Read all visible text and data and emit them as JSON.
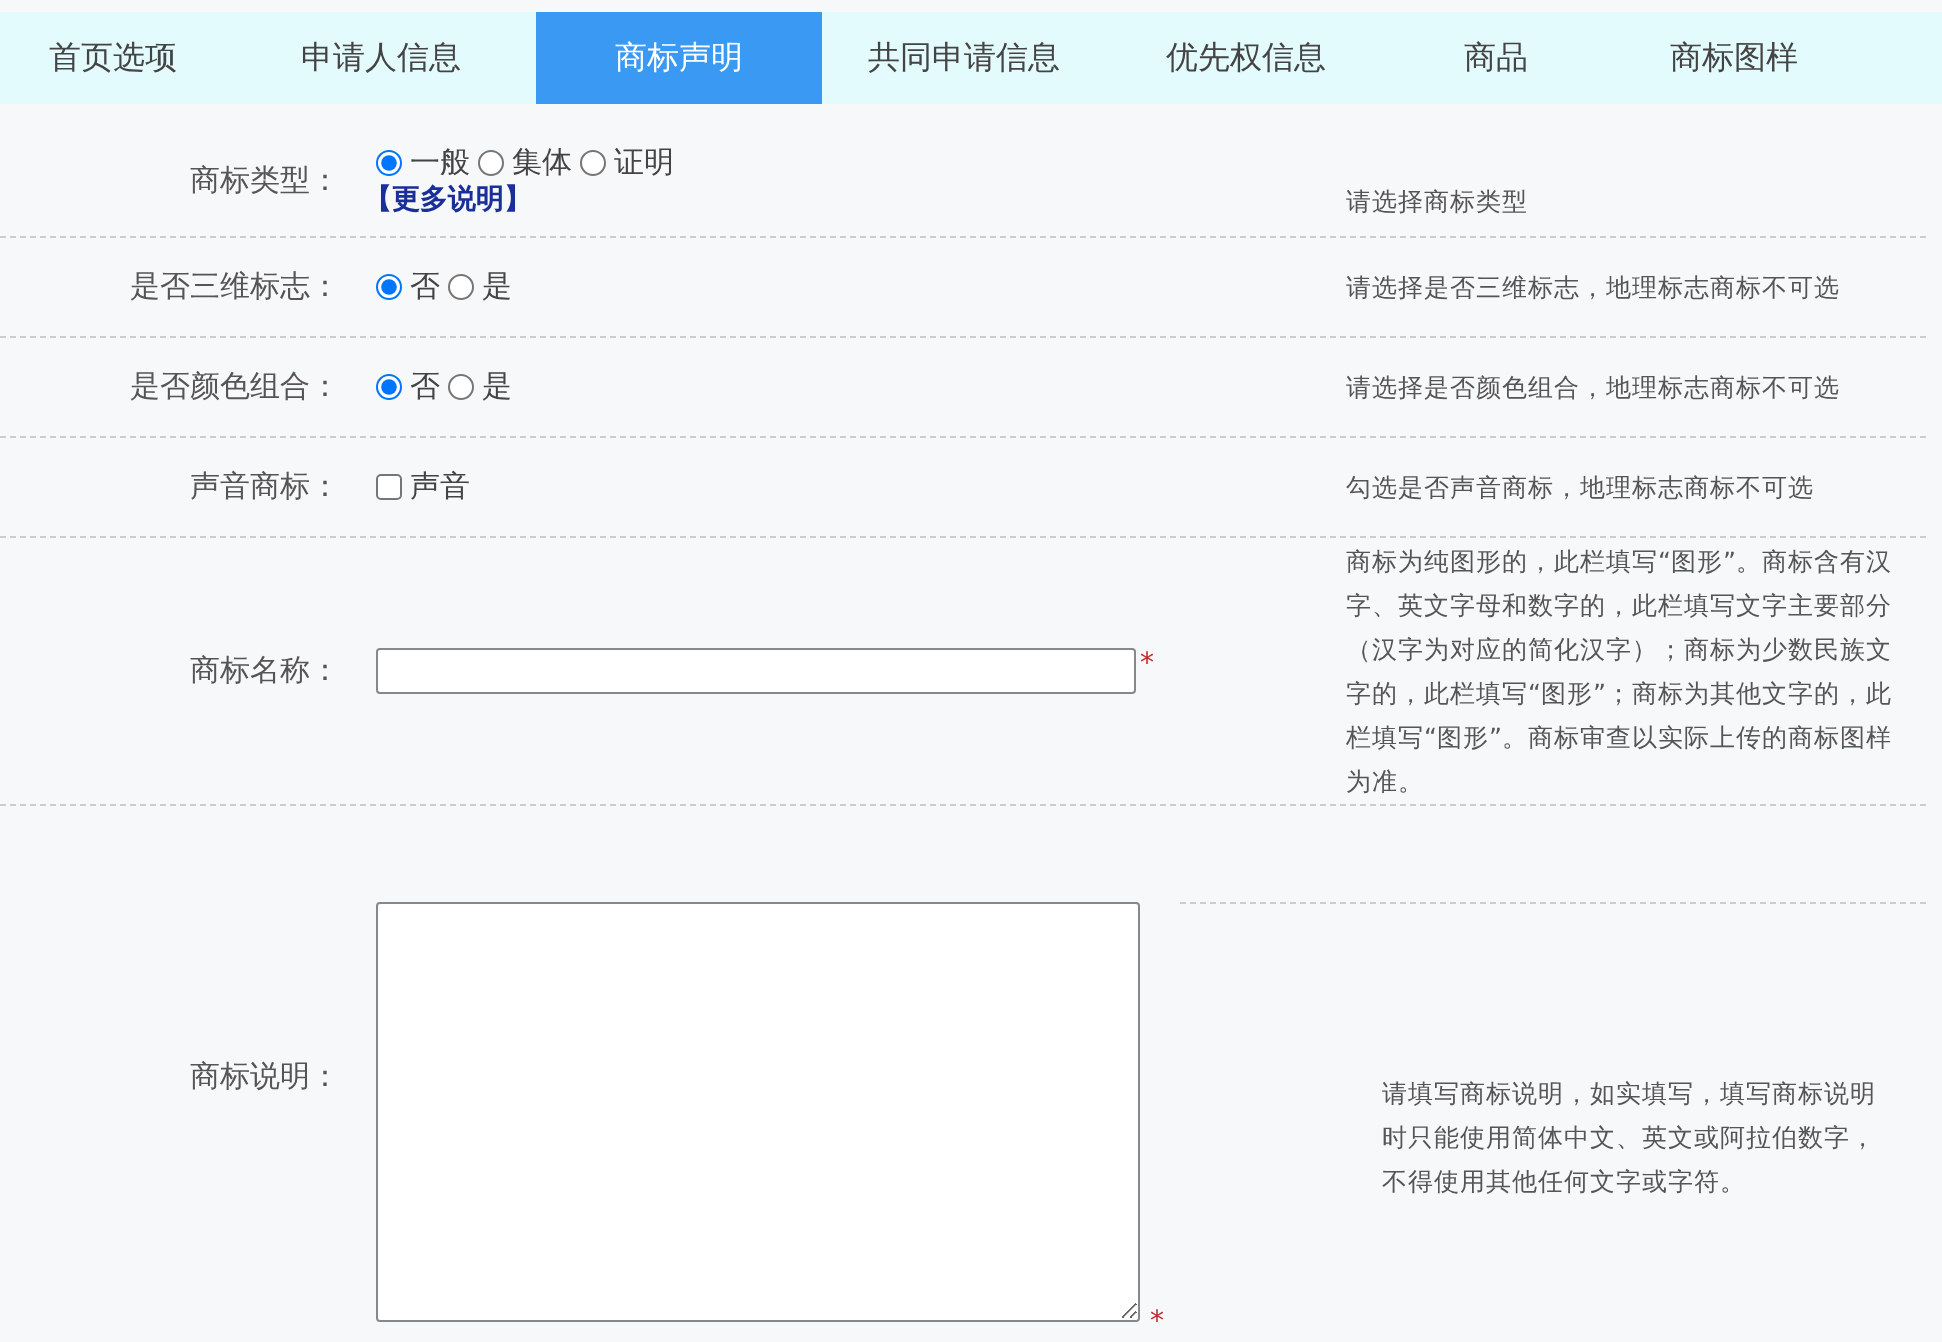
{
  "tabs": [
    {
      "label": "首页选项",
      "selected": false
    },
    {
      "label": "申请人信息",
      "selected": false
    },
    {
      "label": "商标声明",
      "selected": true
    },
    {
      "label": "共同申请信息",
      "selected": false
    },
    {
      "label": "优先权信息",
      "selected": false
    },
    {
      "label": "商品",
      "selected": false
    },
    {
      "label": "商标图样",
      "selected": false
    }
  ],
  "rows": [
    {
      "kind": "radio",
      "label": "商标类型：",
      "options": [
        {
          "label": "一般",
          "selected": true
        },
        {
          "label": "集体",
          "selected": false
        },
        {
          "label": "证明",
          "selected": false
        }
      ],
      "link": "【更多说明】",
      "hint": "请选择商标类型"
    },
    {
      "kind": "radio",
      "label": "是否三维标志：",
      "options": [
        {
          "label": "否",
          "selected": true
        },
        {
          "label": "是",
          "selected": false
        }
      ],
      "hint": "请选择是否三维标志，地理标志商标不可选"
    },
    {
      "kind": "radio",
      "label": "是否颜色组合：",
      "options": [
        {
          "label": "否",
          "selected": true
        },
        {
          "label": "是",
          "selected": false
        }
      ],
      "hint": "请选择是否颜色组合，地理标志商标不可选"
    },
    {
      "kind": "checkbox",
      "label": "声音商标：",
      "options": [
        {
          "label": "声音",
          "checked": false
        }
      ],
      "hint": "勾选是否声音商标，地理标志商标不可选"
    },
    {
      "kind": "text",
      "label": "商标名称：",
      "required_mark": "*",
      "hint": "商标为纯图形的，此栏填写“图形”。商标含有汉字、英文字母和数字的，此栏填写文字主要部分（汉字为对应的简化汉字）；商标为少数民族文字的，此栏填写“图形”；商标为其他文字的，此栏填写“图形”。商标审查以实际上传的商标图样为准。"
    },
    {
      "kind": "textarea",
      "label": "商标说明：",
      "required_mark": "*",
      "hint": "请填写商标说明，如实填写，填写商标说明时只能使用简体中文、英文或阿拉伯数字，不得使用其他任何文字或字符。"
    }
  ]
}
